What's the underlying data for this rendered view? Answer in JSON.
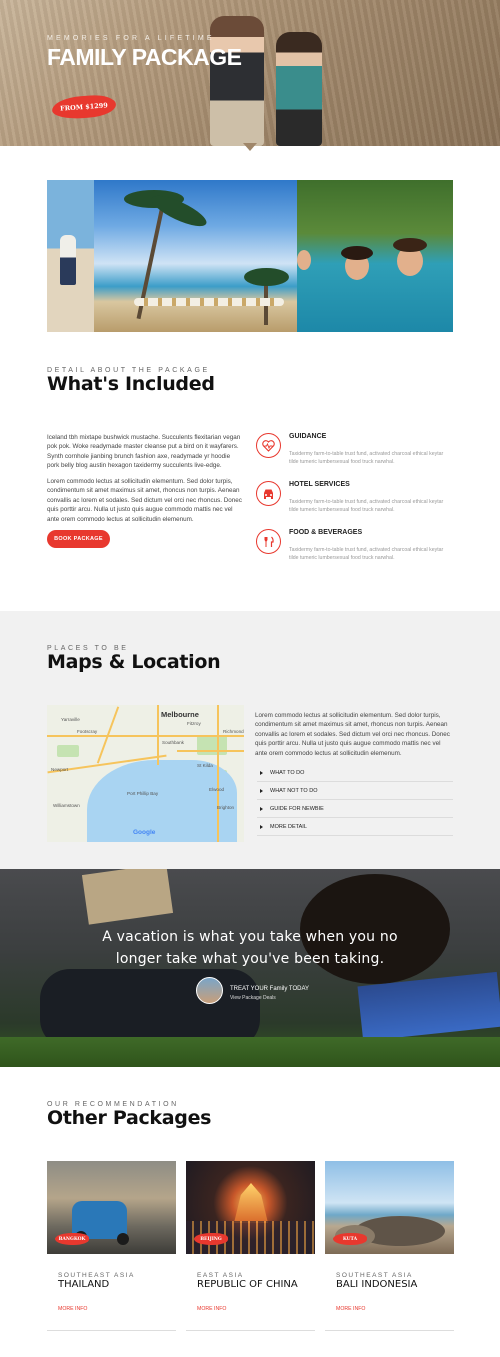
{
  "hero": {
    "kicker": "Memories for a lifetime",
    "title": "FAMILY PACKAGE",
    "price_badge": "FROM $1299"
  },
  "included": {
    "kicker": "Detail about the package",
    "title": "What's Included",
    "para1": "Iceland tbh mixtape bushwick mustache. Succulents flexitarian vegan pok pok. Woke readymade master cleanse put a bird on it wayfarers. Synth cornhole jianbing brunch fashion axe, readymade yr hoodie pork belly blog austin hexagon taxidermy succulents live-edge.",
    "para2": "Lorem commodo lectus at sollicitudin elementum. Sed dolor turpis, condimentum sit amet maximus sit amet, rhoncus non turpis. Aenean convallis ac lorem et sodales. Sed dictum vel orci nec rhoncus. Donec quis porttir arcu. Nulla ut justo quis augue commodo mattis nec vel ante orem commodo lectus at sollicitudin elemenum.",
    "button": "BOOK PACKAGE",
    "features": [
      {
        "title": "GUIDANCE",
        "icon": "heart-pulse-icon",
        "desc": "Taxidermy farm-to-table trust fund, activated charcoal ethical keytar tilde tumeric lumbersexual food truck narwhal."
      },
      {
        "title": "HOTEL SERVICES",
        "icon": "car-icon",
        "desc": "Taxidermy farm-to-table trust fund, activated charcoal ethical keytar tilde tumeric lumbersexual food truck narwhal."
      },
      {
        "title": "FOOD & BEVERAGES",
        "icon": "cutlery-icon",
        "desc": "Taxidermy farm-to-table trust fund, activated charcoal ethical keytar tilde tumeric lumbersexual food truck narwhal."
      }
    ]
  },
  "maps": {
    "kicker": "Places to be",
    "title": "Maps & Location",
    "map_city": "Melbourne",
    "map_labels": [
      "Yarraville",
      "Footscray",
      "Williamstown",
      "Newport",
      "Port Phillip Bay",
      "Southbank",
      "Richmond",
      "St Kilda",
      "Elwood",
      "Brighton",
      "Fitzroy"
    ],
    "map_attribution": "Google",
    "para": "Lorem commodo lectus at sollicitudin elementum. Sed dolor turpis, condimentum sit amet maximus sit amet, rhoncus non turpis. Aenean convallis ac lorem et sodales. Sed dictum vel orci nec rhoncus. Donec quis porttir arcu. Nulla ut justo quis augue commodo mattis nec vel ante orem commodo lectus at sollicitudin elemenum.",
    "accordion": [
      "WHAT TO DO",
      "WHAT NOT TO DO",
      "GUIDE FOR NEWBIE",
      "MORE DETAIL"
    ]
  },
  "banner": {
    "quote_line1": "A vacation is what you take when you no",
    "quote_line2": "longer take what you've been taking.",
    "cta_line1": "TREAT YOUR Family TODAY",
    "cta_line2": "View Package Deals"
  },
  "others": {
    "kicker": "Our recommendation",
    "title": "Other Packages",
    "cards": [
      {
        "tag": "BANGKOK",
        "region": "Southeast Asia",
        "name": "Thailand",
        "more": "More Info"
      },
      {
        "tag": "BEIJING",
        "region": "East Asia",
        "name": "Republic of China",
        "more": "More Info"
      },
      {
        "tag": "KUTA",
        "region": "Southeast Asia",
        "name": "Bali Indonesia",
        "more": "More Info"
      }
    ]
  },
  "colors": {
    "accent": "#e8382e",
    "section_bg": "#f1f1f1"
  }
}
